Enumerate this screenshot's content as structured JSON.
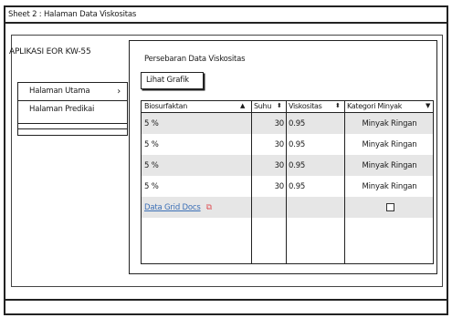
{
  "window": {
    "title": "Sheet 2 : Halaman Data Viskositas"
  },
  "app": {
    "title": "APLIKASI EOR KW-55"
  },
  "nav": {
    "items": [
      {
        "label": "Halaman Utama",
        "icon": "chevron-right-icon"
      },
      {
        "label": "Halaman Predikai"
      }
    ]
  },
  "panel": {
    "title": "Persebaran Data Viskositas",
    "chart_button": "Lihat Grafik"
  },
  "grid": {
    "columns": [
      {
        "label": "Biosurfaktan",
        "sort_icon": "sort-asc-icon"
      },
      {
        "label": "Suhu",
        "sort_icon": "sort-both-icon"
      },
      {
        "label": "Viskositas",
        "sort_icon": "sort-both-icon"
      },
      {
        "label": "Kategori Minyak",
        "sort_icon": "dropdown-icon"
      }
    ],
    "rows": [
      {
        "biosurfaktan": "5 %",
        "suhu": "30",
        "viskositas": "0.95",
        "kategori": "Minyak Ringan"
      },
      {
        "biosurfaktan": "5 %",
        "suhu": "30",
        "viskositas": "0.95",
        "kategori": "Minyak Ringan"
      },
      {
        "biosurfaktan": "5 %",
        "suhu": "30",
        "viskositas": "0.95",
        "kategori": "Minyak Ringan"
      },
      {
        "biosurfaktan": "5 %",
        "suhu": "30",
        "viskositas": "0.95",
        "kategori": "Minyak Ringan"
      }
    ],
    "link": {
      "label": "Data Grid Docs",
      "icon": "external-link-icon"
    },
    "checkbox_checked": false
  }
}
